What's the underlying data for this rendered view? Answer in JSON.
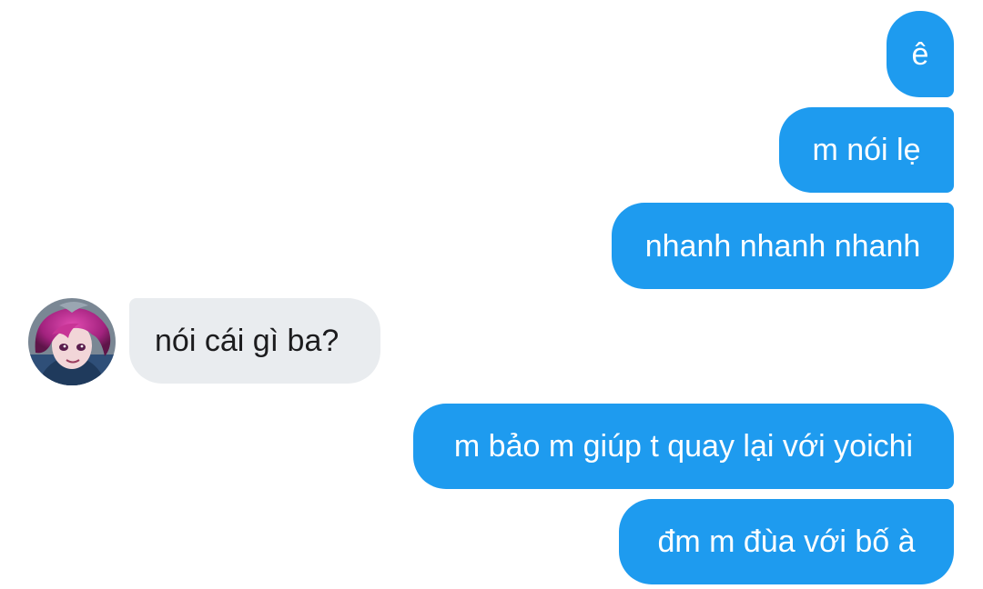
{
  "messages": [
    {
      "sender": "me",
      "text": "ê"
    },
    {
      "sender": "me",
      "text": "m nói lẹ"
    },
    {
      "sender": "me",
      "text": "nhanh nhanh nhanh"
    },
    {
      "sender": "other",
      "text": "nói cái gì ba?"
    },
    {
      "sender": "me",
      "text": "m bảo m giúp t quay lại với yoichi"
    },
    {
      "sender": "me",
      "text": "đm m đùa với bố à"
    }
  ],
  "colors": {
    "outgoing_bubble": "#1e9bef",
    "incoming_bubble": "#e9ecef",
    "outgoing_text": "#ffffff",
    "incoming_text": "#1c1c1e"
  },
  "icons": {
    "avatar": "anime-character-avatar-icon"
  }
}
